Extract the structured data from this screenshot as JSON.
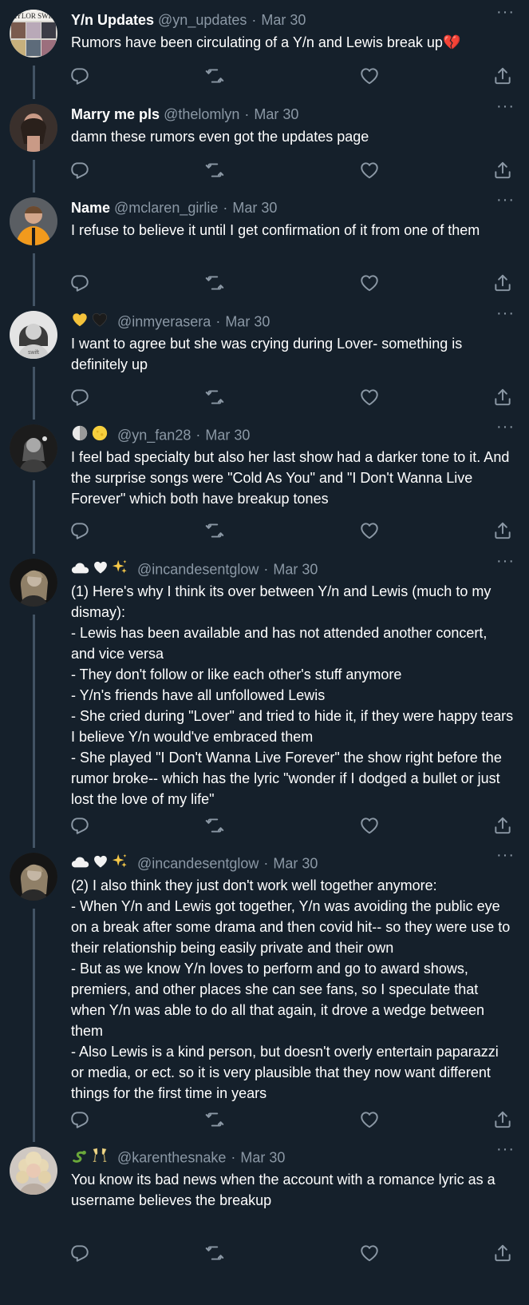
{
  "tweets": [
    {
      "name": "Y/n Updates",
      "handle": "@yn_updates",
      "date": "Mar 30",
      "text": "Rumors have been circulating of a Y/n and Lewis break up💔",
      "avatar": "taylor-swift-collage-avatar"
    },
    {
      "name": "Marry me pls",
      "handle": "@thelomlyn",
      "date": "Mar 30",
      "text": "damn these rumors even got the updates page",
      "avatar": "dark-portrait-avatar"
    },
    {
      "name": "Name",
      "handle": "@mclaren_girlie",
      "date": "Mar 30",
      "text": "I refuse to believe it until I get confirmation of it from one of them",
      "avatar": "orange-jacket-avatar"
    },
    {
      "name": "",
      "name_emojis": "yellow-heart black-heart",
      "handle": "@inmyerasera",
      "date": "Mar 30",
      "text": "I want to agree but she was crying during Lover- something is definitely up",
      "avatar": "bw-portrait-avatar"
    },
    {
      "name": "",
      "name_emojis": "white-moon yellow-moon",
      "handle": "@yn_fan28",
      "date": "Mar 30",
      "text": "I feel bad specialty but also her last show had a darker tone to it. And the surprise songs were \"Cold As You\" and \"I Don't Wanna Live Forever\" which both have breakup tones",
      "avatar": "bw-stage-avatar"
    },
    {
      "name": "",
      "name_emojis": "cloud white-heart sparkles",
      "handle": "@incandesentglow",
      "date": "Mar 30",
      "text": "(1) Here's why I think its over between Y/n and Lewis (much to my dismay):\n- Lewis has been available and has not attended another concert, and vice versa\n- They don't follow or like each other's stuff anymore\n- Y/n's friends have all unfollowed Lewis\n- She cried during \"Lover\" and tried to hide it, if they were happy tears I believe Y/n would've embraced them\n- She played \"I Don't Wanna Live Forever\" the show right before the rumor broke-- which has the lyric \"wonder if I dodged a bullet or just lost the love of my life\"",
      "avatar": "dark-blonde-avatar"
    },
    {
      "name": "",
      "name_emojis": "cloud white-heart sparkles",
      "handle": "@incandesentglow",
      "date": "Mar 30",
      "text": "(2) I also think they just don't work well together anymore:\n- When Y/n and Lewis got together, Y/n was avoiding the public eye on a break after some drama and then covid hit-- so they were use to their relationship being easily private and their own\n- But as we know Y/n loves to perform and go to award shows, premiers, and other places she can see fans, so I speculate that when Y/n was able to do all that again, it drove a wedge between them\n- Also Lewis is a kind person, but doesn't overly entertain paparazzi or media, or ect. so it is very plausible that they now want different things for the first time in years",
      "avatar": "dark-blonde-avatar"
    },
    {
      "name": "",
      "name_emojis": "snake champagne-glasses",
      "handle": "@karenthesnake",
      "date": "Mar 30",
      "text": "You know its bad news when the account with a romance lyric as a username believes the breakup",
      "avatar": "blonde-curly-avatar"
    }
  ],
  "icons": {
    "more": "more-icon",
    "reply": "reply-icon",
    "retweet": "retweet-icon",
    "like": "like-icon",
    "share": "share-icon"
  },
  "colors": {
    "background": "#15202b",
    "primary_text": "#ffffff",
    "secondary_text": "#8b98a5",
    "thread_line": "#425364"
  }
}
